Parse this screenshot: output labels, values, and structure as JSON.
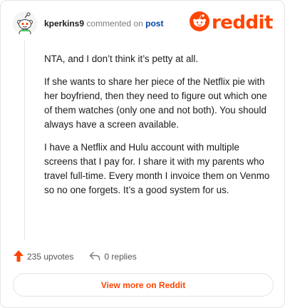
{
  "header": {
    "username": "kperkins9",
    "commented_on": "commented on",
    "post_link": "post",
    "logo_text": "reddit"
  },
  "comment": {
    "paragraphs": [
      "NTA, and I don’t think it’s petty at all.",
      "If she wants to share her piece of the Netflix pie with her boyfriend, then they need to figure out which one of them watches (only one and not both). You should always have a screen available.",
      "I have a Netflix and Hulu account with multiple screens that I pay for. I share it with my parents who travel full-time. Every month I invoice them on Venmo so no one forgets. It’s a good system for us."
    ]
  },
  "actions": {
    "upvotes_label": "235 upvotes",
    "replies_label": "0 replies"
  },
  "footer": {
    "view_more_label": "View more on Reddit"
  },
  "colors": {
    "brand": "#ff4500",
    "link": "#0045ac",
    "text": "#1c1c1c",
    "muted": "#7c7c7c",
    "border": "#e4e4e4"
  },
  "icons": {
    "avatar": "snoo-avatar-icon",
    "logo": "reddit-logo-icon",
    "upvote": "upvote-arrow-icon",
    "reply": "reply-icon"
  }
}
